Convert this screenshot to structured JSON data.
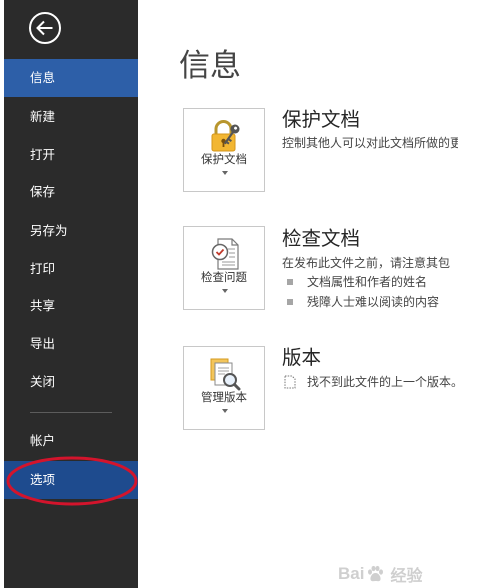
{
  "sidebar": {
    "back_icon": "back-arrow-icon",
    "items": [
      {
        "label": "信息",
        "selected": true
      },
      {
        "label": "新建"
      },
      {
        "label": "打开"
      },
      {
        "label": "保存"
      },
      {
        "label": "另存为"
      },
      {
        "label": "打印"
      },
      {
        "label": "共享"
      },
      {
        "label": "导出"
      },
      {
        "label": "关闭"
      }
    ],
    "footer_items": [
      {
        "label": "帐户"
      },
      {
        "label": "选项",
        "highlighted": true
      }
    ]
  },
  "main": {
    "title": "信息",
    "sections": [
      {
        "button_label": "保护文档",
        "icon": "lock-key-icon",
        "heading": "保护文档",
        "description": "控制其他人可以对此文档所做的更"
      },
      {
        "button_label": "检查问题",
        "icon": "inspect-document-icon",
        "heading": "检查文档",
        "description": "在发布此文件之前，请注意其包",
        "bullets": [
          "文档属性和作者的姓名",
          "残障人士难以阅读的内容"
        ]
      },
      {
        "button_label": "管理版本",
        "icon": "manage-versions-icon",
        "heading": "版本",
        "note_icon": "version-document-icon",
        "note": "找不到此文件的上一个版本。"
      }
    ]
  },
  "colors": {
    "sidebar_bg": "#2b2b2b",
    "selected_bg": "#2d5fa8",
    "options_bg": "#1e4b8e",
    "annotation": "#d3142c",
    "tile_border": "#c8c8c8"
  },
  "watermark": {
    "text_left": "Bai",
    "icon": "paw-icon",
    "text_right": "经验"
  }
}
